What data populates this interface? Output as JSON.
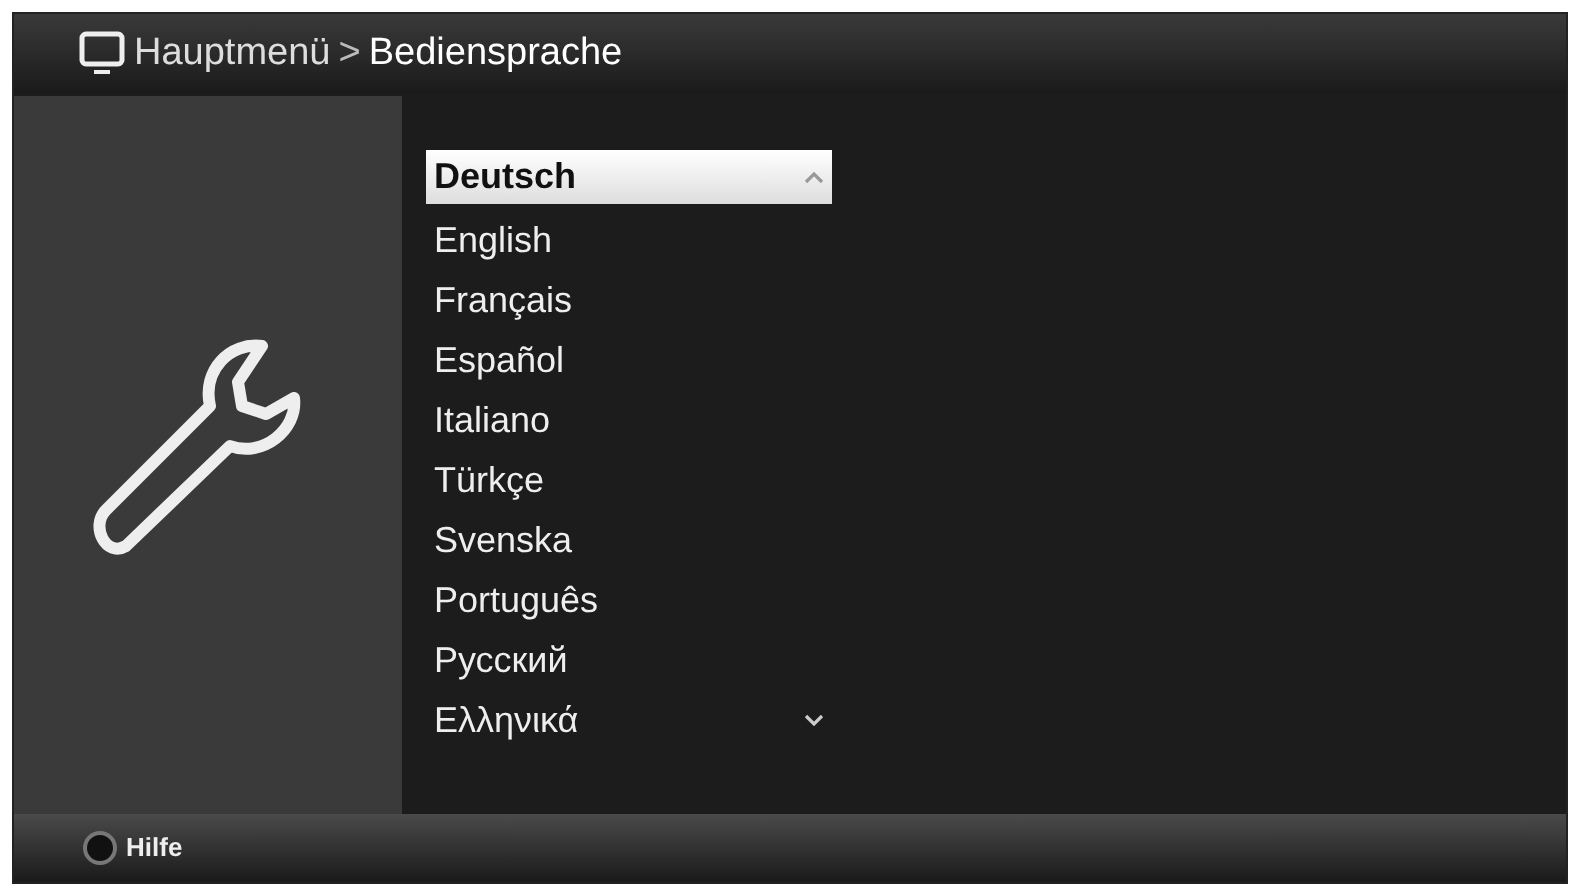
{
  "header": {
    "breadcrumb": [
      "Hauptmenü",
      "Bediensprache"
    ],
    "separator": ">"
  },
  "languages": [
    {
      "label": "Deutsch",
      "selected": true
    },
    {
      "label": "English",
      "selected": false
    },
    {
      "label": "Français",
      "selected": false
    },
    {
      "label": "Español",
      "selected": false
    },
    {
      "label": "Italiano",
      "selected": false
    },
    {
      "label": "Türkçe",
      "selected": false
    },
    {
      "label": "Svenska",
      "selected": false
    },
    {
      "label": "Português",
      "selected": false
    },
    {
      "label": "Русский",
      "selected": false
    },
    {
      "label": "Ελληνικά",
      "selected": false
    }
  ],
  "footer": {
    "help": "Hilfe"
  }
}
